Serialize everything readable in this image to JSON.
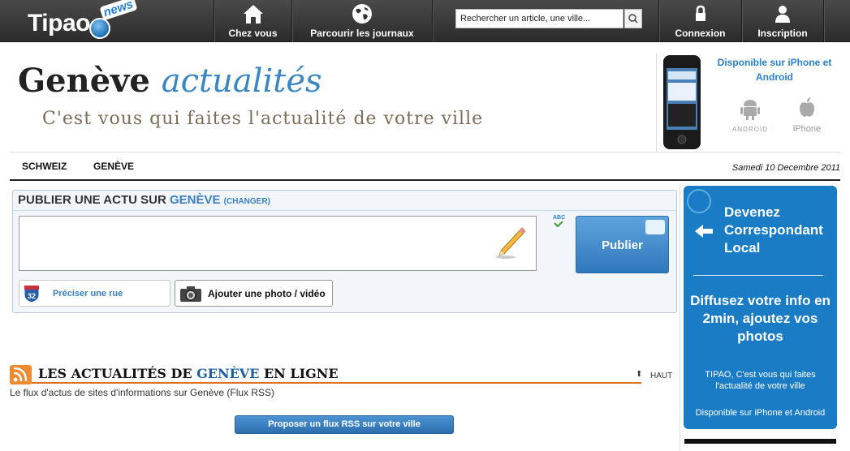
{
  "topbar": {
    "logo_text": "Tipao",
    "logo_badge": "news",
    "nav": [
      {
        "label": "Chez vous",
        "icon": "home-icon"
      },
      {
        "label": "Parcourir les journaux",
        "icon": "globe-icon"
      },
      {
        "label": "Connexion",
        "icon": "lock-icon"
      },
      {
        "label": "Inscription",
        "icon": "user-icon"
      }
    ],
    "search_placeholder": "Rechercher un article, une ville..."
  },
  "header": {
    "title_main": "Genève",
    "title_accent": "actualités",
    "slogan": "C'est vous qui faites l'actualité de votre ville",
    "app_title": "Disponible sur iPhone et Android",
    "android_label": "ANDROID",
    "iphone_label": "iPhone"
  },
  "breadcrumb": {
    "items": [
      "SCHWEIZ",
      "GENÈVE"
    ],
    "date": "Samedi 10 Decembre 2011"
  },
  "publish": {
    "heading_prefix": "PUBLIER UNE ACTU SUR",
    "heading_city": "GENÈVE",
    "heading_change": "(CHANGER)",
    "spellcheck_label": "ABC",
    "publish_label": "Publier",
    "street_label": "Préciser une rue",
    "street_shield_number": "32",
    "photo_label": "Ajouter une photo / vidéo"
  },
  "feed": {
    "title_prefix": "LES ACTUALITÉS DE",
    "title_city": "GENÈVE",
    "title_suffix": "EN LIGNE",
    "top_label": "HAUT",
    "subtitle": "Le flux d'actus de sites d'informations sur Genève (Flux RSS)",
    "propose_label": "Proposer un flux RSS sur votre ville"
  },
  "sidebar": {
    "heading": "Devenez Correspondant Local",
    "main": "Diffusez votre info en 2min, ajoutez vos photos",
    "small": "TIPAO, C'est vous qui faites l'actualité de votre ville",
    "available": "Disponible sur iPhone et Android"
  },
  "colors": {
    "accent_blue": "#3a86c4",
    "promo_blue": "#1a7cc4",
    "rss_orange": "#e0701a",
    "topbar_dark": "#333333"
  }
}
